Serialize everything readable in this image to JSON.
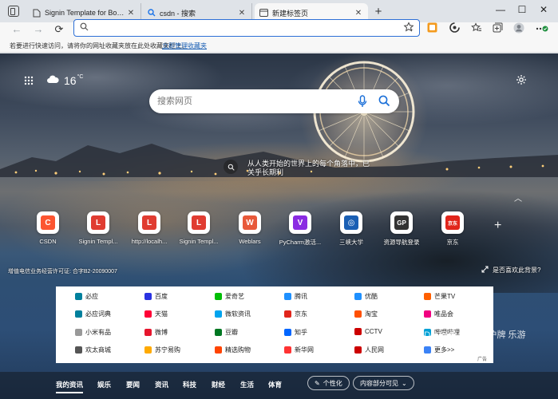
{
  "tabs": [
    {
      "title": "Signin Template for Bootstrap",
      "icon": "document-icon",
      "active": false
    },
    {
      "title": "csdn - 搜索",
      "icon": "search-icon",
      "active": false
    },
    {
      "title": "新建标签页",
      "icon": "newtab-page-icon",
      "active": true
    }
  ],
  "window_controls": {
    "minimize": "—",
    "maximize": "☐",
    "close": "✕"
  },
  "address_bar": {
    "value": "",
    "placeholder": ""
  },
  "favorites_bar": {
    "message": "若要进行快速访问，请将你的网址收藏夹放在此处收藏夹栏上。",
    "link": "立即管理收藏夹"
  },
  "weather": {
    "temperature": "16",
    "unit": "°C"
  },
  "search": {
    "placeholder": "搜索网页"
  },
  "image_caption": "从人类开始的世界上的每个角落中，已关乎长期利",
  "quick_links": [
    {
      "label": "CSDN",
      "badge": "C",
      "color": "#fc5531"
    },
    {
      "label": "Signin Templ...",
      "badge": "L",
      "color": "#e03c31"
    },
    {
      "label": "http://localh...",
      "badge": "L",
      "color": "#e03c31"
    },
    {
      "label": "Signin Templ...",
      "badge": "L",
      "color": "#e03c31"
    },
    {
      "label": "Weblars",
      "badge": "W",
      "color": "#e8593a"
    },
    {
      "label": "PyCharm激活...",
      "badge": "V",
      "color": "#8a2be2"
    },
    {
      "label": "三峡大学",
      "badge": "◎",
      "color": "#1a5fb4"
    },
    {
      "label": "资源导航登录",
      "badge": "GP",
      "color": "#333333"
    },
    {
      "label": "京东",
      "badge": "京东",
      "color": "#e1251b"
    }
  ],
  "icp_text": "增值电信业务经营许可证: 合字B2-20090007",
  "like_background": "是否喜欢此背景?",
  "links": [
    [
      "必应",
      "百度",
      "爱奇艺",
      "腾讯",
      "优酷",
      "芒果TV"
    ],
    [
      "必应词典",
      "天猫",
      "微软资讯",
      "京东",
      "淘宝",
      "唯品会"
    ],
    [
      "小米有品",
      "微博",
      "豆瓣",
      "知乎",
      "CCTV",
      "哔哩哔哩"
    ],
    [
      "欢太商城",
      "苏宁易购",
      "精选购物",
      "新华网",
      "人民网",
      "更多>>"
    ]
  ],
  "link_colors": [
    [
      "#00809d",
      "#2932e1",
      "#00be06",
      "#1e90ff",
      "#1e90ff",
      "#ff5f00"
    ],
    [
      "#00809d",
      "#ff0036",
      "#00a4ef",
      "#e1251b",
      "#ff5000",
      "#f10180"
    ],
    [
      "#999999",
      "#e6162d",
      "#007722",
      "#0066ff",
      "#cc0000",
      "#00a1d6"
    ],
    [
      "#555555",
      "#ffaa00",
      "#ff4400",
      "#ff3333",
      "#cc0000",
      "#3b82f6"
    ]
  ],
  "ad_label": "广告",
  "feed_tabs": [
    "我的资讯",
    "娱乐",
    "要闻",
    "资讯",
    "科技",
    "财经",
    "生活",
    "体育"
  ],
  "personalize": "个性化",
  "content_settings": "内容部分可见",
  "watermark": "CSDN @萝卜炖.猪 沪牌 乐游"
}
